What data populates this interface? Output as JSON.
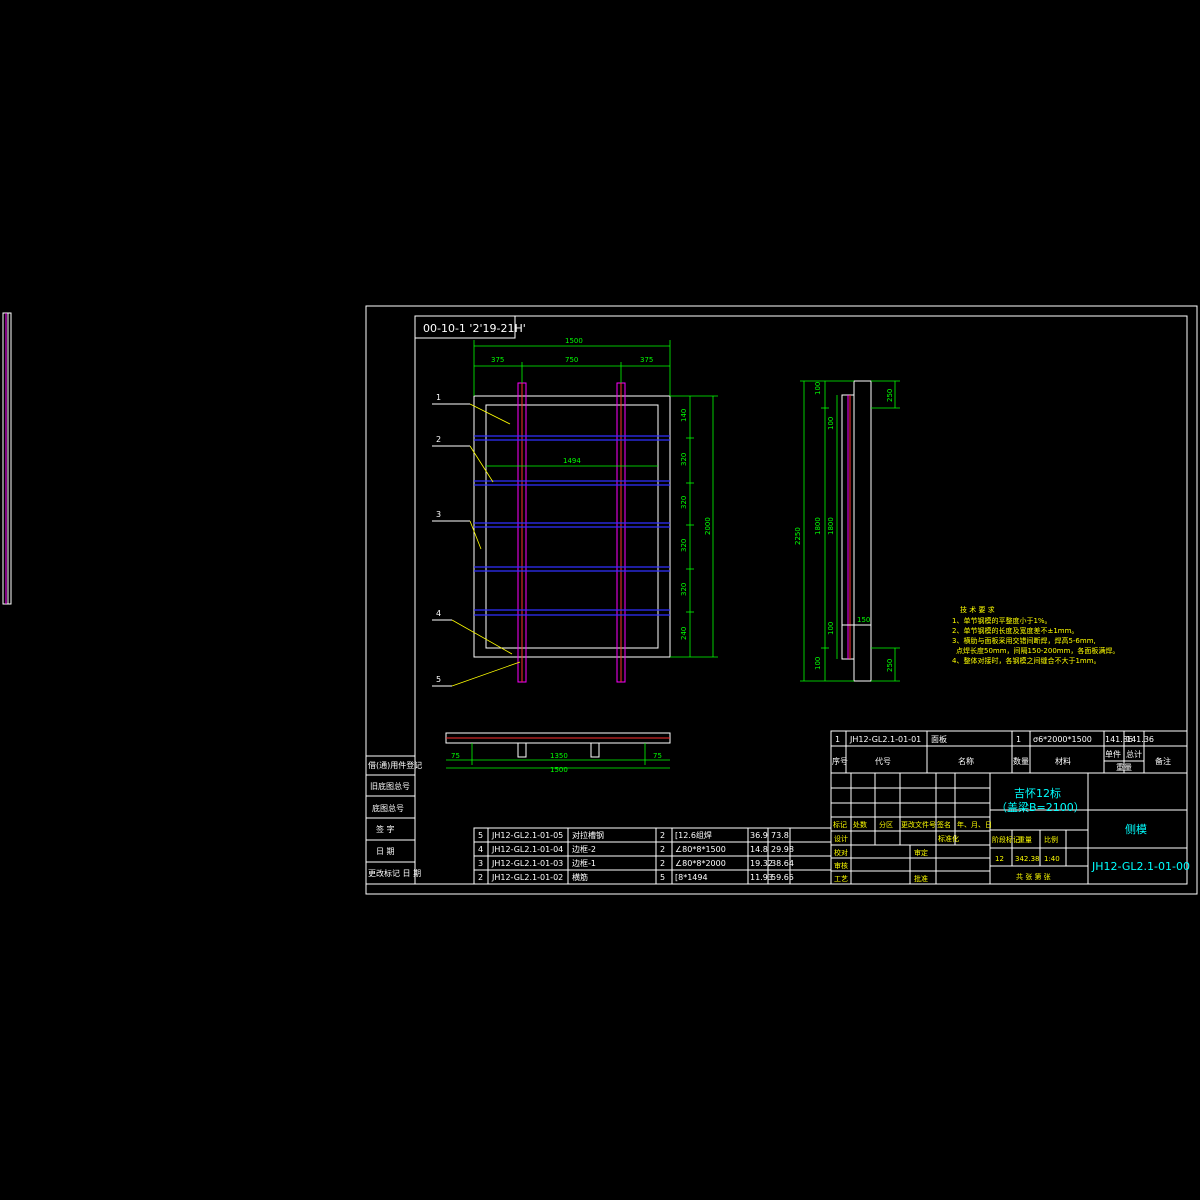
{
  "drawing": {
    "title_box": "00-10-1 '2'19-21H'",
    "colors": {
      "background": "#000000",
      "frame": "#ffffff",
      "dimension": "#00ff00",
      "leader": "#ffff00",
      "stiffener": "#3030ff",
      "post": "#ff00ff",
      "title": "#00ffff"
    }
  },
  "front_view": {
    "dims_top": {
      "overall": "1500",
      "left": "375",
      "middle": "750",
      "right": "375"
    },
    "inner_width": "1494",
    "dims_right": [
      "140",
      "320",
      "320",
      "320",
      "320",
      "240"
    ],
    "height": "2000",
    "callouts": [
      "1",
      "2",
      "3",
      "4",
      "5"
    ]
  },
  "side_view": {
    "dims_left": [
      "100",
      "1800",
      "100"
    ],
    "total": "2250",
    "dims_inner": [
      "100",
      "1800",
      "100"
    ],
    "dims_right": [
      "250",
      "250"
    ],
    "extra": "150"
  },
  "plan_view": {
    "left": "75",
    "right": "75",
    "mid": "1350",
    "total": "1500"
  },
  "tech_requirements": {
    "title": "技 术 要 求",
    "items": [
      "1、单节钢模的平整度小于1%。",
      "2、单节钢模的长度及宽度差不±1mm。",
      "3、横肋与面板采用交错间断焊，焊高5-6mm,",
      "点焊长度50mm，间隔150-200mm，各面板满焊。",
      "4、整体对接时，各钢模之间缝合不大于1mm。"
    ]
  },
  "parts_list": [
    {
      "no": "5",
      "code": "JH12-GL2.1-01-05",
      "name": "对拉槽钢",
      "qty": "2",
      "material": "[12.6组焊",
      "unit": "36.9",
      "total": "73.8"
    },
    {
      "no": "4",
      "code": "JH12-GL2.1-01-04",
      "name": "边框-2",
      "qty": "2",
      "material": "∠80*8*1500",
      "unit": "14.8",
      "total": "29.98"
    },
    {
      "no": "3",
      "code": "JH12-GL2.1-01-03",
      "name": "边框-1",
      "qty": "2",
      "material": "∠80*8*2000",
      "unit": "19.32",
      "total": "38.64"
    },
    {
      "no": "2",
      "code": "JH12-GL2.1-01-02",
      "name": "横筋",
      "qty": "5",
      "material": "[8*1494",
      "unit": "11.93",
      "total": "59.65"
    }
  ],
  "part1": {
    "no": "1",
    "code": "JH12-GL2.1-01-01",
    "name": "面板",
    "qty": "1",
    "material": "σ6*2000*1500",
    "unit": "141.36",
    "total": "141.36"
  },
  "table_header": {
    "no": "序号",
    "code": "代号",
    "name": "名称",
    "qty": "数量",
    "material": "材料",
    "unit": "单件",
    "total": "总计",
    "weight": "重量",
    "remark": "备注"
  },
  "title_block": {
    "project": "吉怀12标",
    "subtitle": "（盖梁B=2100）",
    "part_name": "侧模",
    "drawing_no": "JH12-GL2.1-01-00",
    "qty": "12",
    "weight": "342.38",
    "scale": "1:40",
    "rev_header": [
      "标记",
      "处数",
      "分区",
      "更改文件号",
      "签名",
      "年、月、日"
    ],
    "roles": [
      "设计",
      "校对",
      "审核",
      "工艺"
    ],
    "roles2": [
      "标准化",
      "审定",
      "",
      "批准"
    ],
    "stage_header": [
      "阶段标记",
      "重量",
      "比例"
    ],
    "sheet": "共 张 第 张"
  },
  "left_stamp": {
    "rows": [
      "借(通)用件登记",
      "旧底图总号",
      "底图总号",
      "签 字",
      "日 期",
      "更改标记 日 期"
    ]
  }
}
